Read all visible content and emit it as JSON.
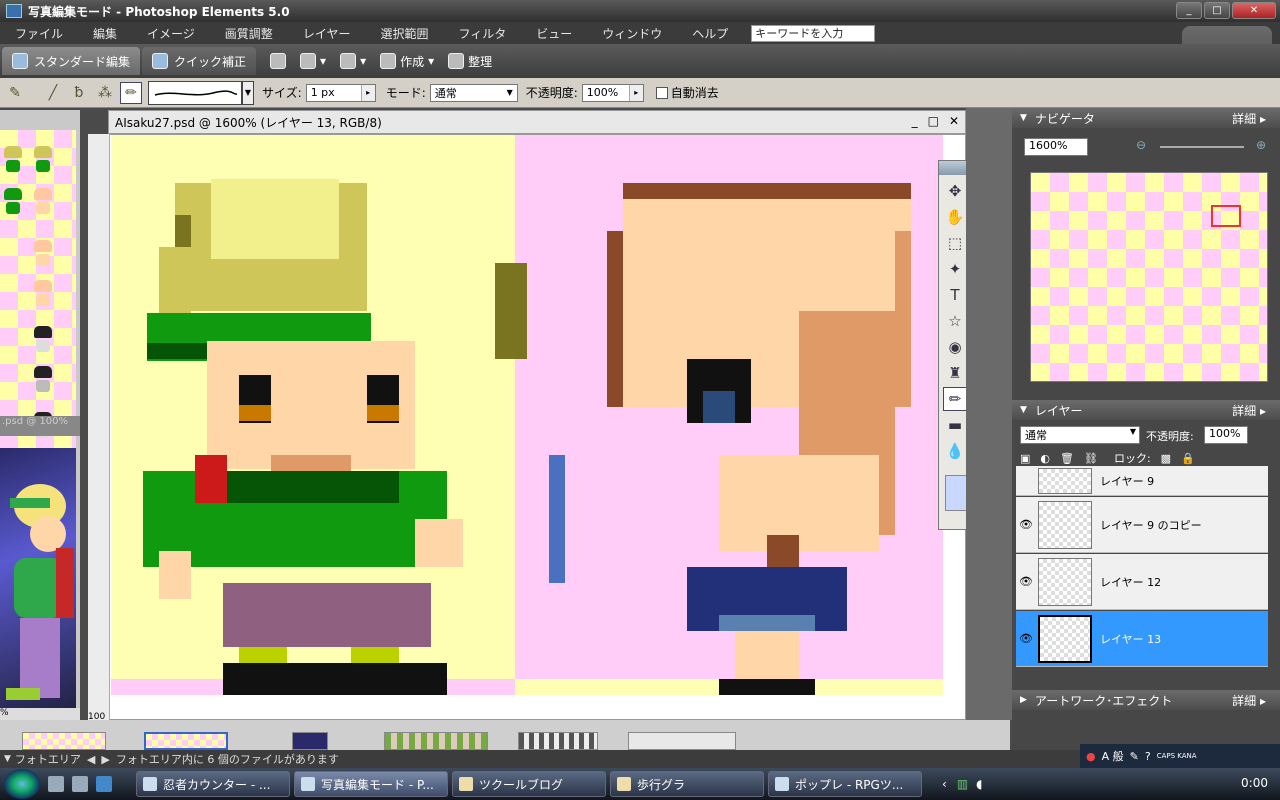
{
  "window": {
    "title": "写真編集モード - Photoshop Elements 5.0"
  },
  "menu": {
    "items": [
      "ファイル",
      "編集",
      "イメージ",
      "画質調整",
      "レイヤー",
      "選択範囲",
      "フィルタ",
      "ビュー",
      "ウィンドウ",
      "ヘルプ"
    ],
    "search_value": "キーワードを入力"
  },
  "modebar": {
    "standard_edit": "スタンダード編集",
    "quick_fix": "クイック補正",
    "create": "作成",
    "organize": "整理"
  },
  "options": {
    "size_label": "サイズ:",
    "size_value": "1 px",
    "mode_label": "モード:",
    "mode_value": "通常",
    "opacity_label": "不透明度:",
    "opacity_value": "100%",
    "auto_erase_label": "自動消去"
  },
  "document": {
    "title": "AIsaku27.psd @ 1600% (レイヤー 13, RGB/8)"
  },
  "left_strip": {
    "caption": ".psd @ 100%",
    "zoom_label": "%",
    "ruler_tick": "100"
  },
  "navigator": {
    "title": "ナビゲータ",
    "more": "詳細",
    "zoom": "1600%"
  },
  "layers": {
    "title": "レイヤー",
    "more": "詳細",
    "blend": "通常",
    "opacity_label": "不透明度:",
    "opacity": "100%",
    "lock_label": "ロック:",
    "rows": [
      {
        "name": "レイヤー 9",
        "visible": false,
        "selected": false
      },
      {
        "name": "レイヤー 9 のコピー",
        "visible": true,
        "selected": false
      },
      {
        "name": "レイヤー 12",
        "visible": true,
        "selected": false
      },
      {
        "name": "レイヤー 13",
        "visible": true,
        "selected": true
      }
    ]
  },
  "artwork": {
    "title": "アートワーク･エフェクト",
    "more": "詳細"
  },
  "photobin": {
    "label": "フォトエリア",
    "status": "フォトエリア内に 6 個のファイルがあります"
  },
  "tray": {
    "ime": "A 般",
    "caps": "CAPS KANA"
  },
  "taskbar": {
    "items": [
      {
        "label": "忍者カウンター - ...",
        "active": false
      },
      {
        "label": "写真編集モード - P...",
        "active": true
      },
      {
        "label": "ツクールブログ",
        "active": false
      },
      {
        "label": "歩行グラ",
        "active": false
      },
      {
        "label": "ポップレ - RPGツ...",
        "active": false
      }
    ],
    "clock": "0:00"
  },
  "colors": {
    "canvas_yellow": "#ffffb4",
    "canvas_pink": "#ffcdf7",
    "selection_blue": "#3399ff",
    "hair_light": "#f2f08c",
    "hair_mid": "#cfc65a",
    "hair_dark": "#7a7320",
    "green": "#109a10",
    "green_dark": "#065406",
    "skin": "#ffd6a8",
    "skin_dark": "#e09a68",
    "brown": "#8a4a2a",
    "pants": "#8f6080",
    "navy": "#22307a"
  }
}
